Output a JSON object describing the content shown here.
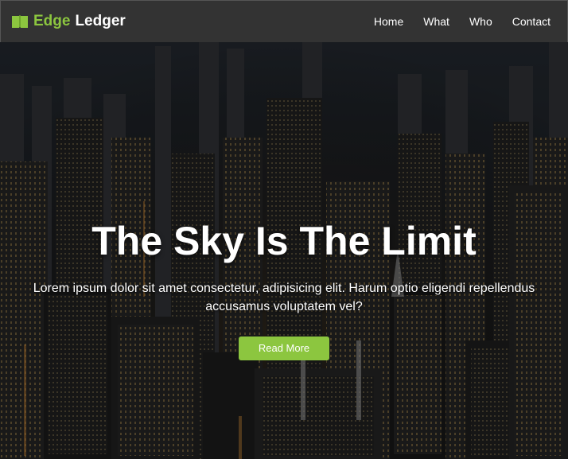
{
  "navbar": {
    "brand_accent": "Edge",
    "brand_rest": "Ledger",
    "brand_icon": "book-icon",
    "links": [
      "Home",
      "What",
      "Who",
      "Contact"
    ]
  },
  "hero": {
    "title": "The Sky Is The Limit",
    "text": "Lorem ipsum dolor sit amet consectetur, adipisicing elit. Harum optio eligendi repellendus accusamus voluptatem vel?",
    "button": "Read More"
  },
  "colors": {
    "accent": "#8cc63f",
    "navbar_bg": "#333333",
    "text": "#ffffff"
  }
}
